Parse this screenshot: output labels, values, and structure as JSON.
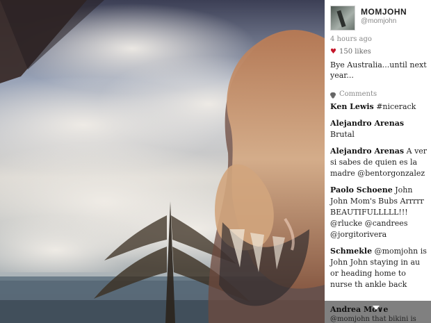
{
  "post": {
    "user": {
      "display_name": "MOMJOHN",
      "handle": "@momjohn"
    },
    "time": "4 hours ago",
    "likes_text": "150 likes",
    "caption": "Bye Australia...until next year...",
    "comments_label": "Comments"
  },
  "comments": [
    {
      "author": "Ken Lewis",
      "text": "#nicerack"
    },
    {
      "author": "Alejandro Arenas",
      "text": "Brutal"
    },
    {
      "author": "Alejandro Arenas",
      "text": "A ver si sabes de quien es la madre @bentorgonzalez"
    },
    {
      "author": "Paolo Schoene",
      "text": "John John Mom's Bubs Arrrrr BEAUTIFULLLLL!!! @rlucke @candrees @jorgitorivera"
    },
    {
      "author": "Schmekle",
      "text": "@momjohn is John John staying in au or heading home to nurse th ankle back"
    }
  ],
  "bottom_comment": {
    "author": "Andrea Mo∨e",
    "text": "@momjohn that bikini is"
  },
  "icons": {
    "like": "heart-icon",
    "comments": "comment-bubble-icon",
    "scroll": "chevron-down-icon"
  },
  "colors": {
    "heart": "#c4162a"
  }
}
